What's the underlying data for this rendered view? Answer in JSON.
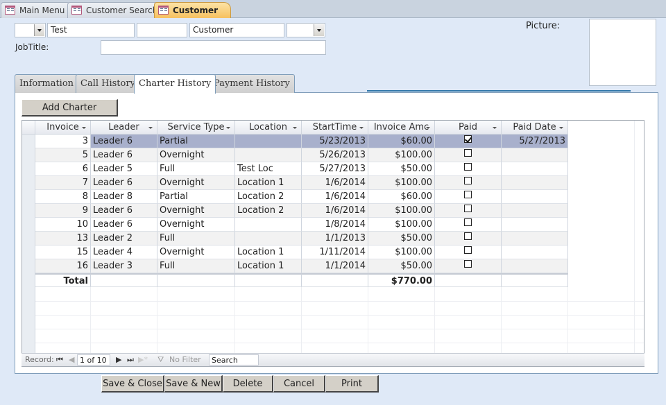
{
  "doc_tabs": [
    {
      "label": "Main Menu",
      "active": false
    },
    {
      "label": "Customer Search",
      "active": false
    },
    {
      "label": "Customer",
      "active": true
    }
  ],
  "header": {
    "prefix_combo": "",
    "first_name": "Test",
    "middle_name": "",
    "last_name": "Customer",
    "suffix_combo": "",
    "job_title_label": "JobTitle:",
    "job_title_value": "",
    "picture_label": "Picture:"
  },
  "tabs": [
    {
      "label": "Information",
      "active": false
    },
    {
      "label": "Call History",
      "active": false
    },
    {
      "label": "Charter History",
      "active": true
    },
    {
      "label": "Payment History",
      "active": false
    }
  ],
  "add_charter_label": "Add Charter",
  "grid": {
    "columns": [
      "Invoice",
      "Leader",
      "Service Type",
      "Location",
      "StartTime",
      "Invoice Amc",
      "Paid",
      "Paid Date"
    ],
    "rows": [
      {
        "invoice": "3",
        "leader": "Leader 6",
        "service": "Partial",
        "location": "",
        "start": "5/23/2013",
        "amount": "$60.00",
        "paid": true,
        "paid_date": "5/27/2013"
      },
      {
        "invoice": "5",
        "leader": "Leader 6",
        "service": "Overnight",
        "location": "",
        "start": "5/26/2013",
        "amount": "$100.00",
        "paid": false,
        "paid_date": ""
      },
      {
        "invoice": "6",
        "leader": "Leader 5",
        "service": "Full",
        "location": "Test Loc",
        "start": "5/27/2013",
        "amount": "$50.00",
        "paid": false,
        "paid_date": ""
      },
      {
        "invoice": "7",
        "leader": "Leader 6",
        "service": "Overnight",
        "location": "Location 1",
        "start": "1/6/2014",
        "amount": "$100.00",
        "paid": false,
        "paid_date": ""
      },
      {
        "invoice": "8",
        "leader": "Leader 8",
        "service": "Partial",
        "location": "Location 2",
        "start": "1/6/2014",
        "amount": "$60.00",
        "paid": false,
        "paid_date": ""
      },
      {
        "invoice": "9",
        "leader": "Leader 6",
        "service": "Overnight",
        "location": "Location 2",
        "start": "1/6/2014",
        "amount": "$100.00",
        "paid": false,
        "paid_date": ""
      },
      {
        "invoice": "10",
        "leader": "Leader 6",
        "service": "Overnight",
        "location": "",
        "start": "1/8/2014",
        "amount": "$100.00",
        "paid": false,
        "paid_date": ""
      },
      {
        "invoice": "13",
        "leader": "Leader 2",
        "service": "Full",
        "location": "",
        "start": "1/1/2013",
        "amount": "$50.00",
        "paid": false,
        "paid_date": ""
      },
      {
        "invoice": "15",
        "leader": "Leader 4",
        "service": "Overnight",
        "location": "Location 1",
        "start": "1/11/2014",
        "amount": "$100.00",
        "paid": false,
        "paid_date": ""
      },
      {
        "invoice": "16",
        "leader": "Leader 3",
        "service": "Full",
        "location": "Location 1",
        "start": "1/1/2014",
        "amount": "$50.00",
        "paid": false,
        "paid_date": ""
      }
    ],
    "total_label": "Total",
    "total_amount": "$770.00"
  },
  "navbar": {
    "record_label": "Record:",
    "position": "1 of 10",
    "filter_label": "No Filter",
    "search_placeholder": "Search"
  },
  "buttons": {
    "save_close": "Save & Close",
    "save_new": "Save & New",
    "delete": "Delete",
    "cancel": "Cancel",
    "print": "Print"
  }
}
